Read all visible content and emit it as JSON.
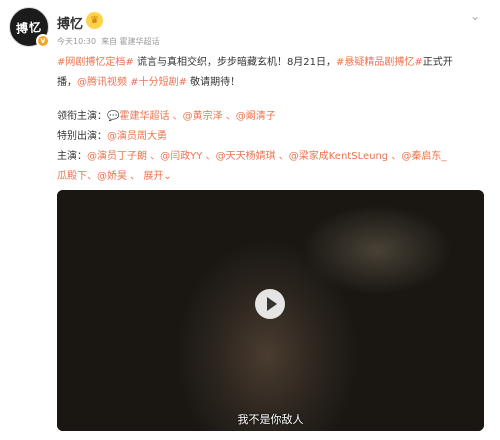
{
  "post": {
    "avatar_text": "搏忆",
    "username": "搏忆",
    "vip_icon": "crown-icon",
    "timestamp": "今天10:30",
    "source": "来自 霍建华超话",
    "text": {
      "line1": [
        {
          "t": "#网剧搏忆定档#",
          "orange": true
        },
        {
          "t": " 谎言与真相交织，步步暗藏玄机！8月21日，",
          "orange": false
        },
        {
          "t": "#悬疑精品剧搏忆#",
          "orange": true
        },
        {
          "t": "正式开",
          "orange": false
        }
      ],
      "line2": [
        {
          "t": "播，",
          "orange": false
        },
        {
          "t": "@腾讯视频",
          "orange": true
        },
        {
          "t": " ",
          "orange": false
        },
        {
          "t": "#十分短剧#",
          "orange": true
        },
        {
          "t": " 敬请期待！",
          "orange": false
        }
      ],
      "lead_label": "领衔主演：",
      "lead_actors": "💬霍建华超话 、@黄宗泽 、@阚清子",
      "special_label": "特别出演：",
      "special_actors": "@演员周大勇",
      "cast_label": "主演：",
      "cast_line1": "@演员丁子朗 、@闫政YY 、@天天杨婧琪 、@梁家成KentSLeung 、@秦启东_",
      "cast_line2": "瓜殿下、@娇昊 、",
      "expand": "展开⌄"
    },
    "video": {
      "subtitle": "我不是你敌人"
    },
    "colors": {
      "accent": "#eb7350",
      "text": "#333333",
      "meta": "#9a9a9a"
    }
  }
}
